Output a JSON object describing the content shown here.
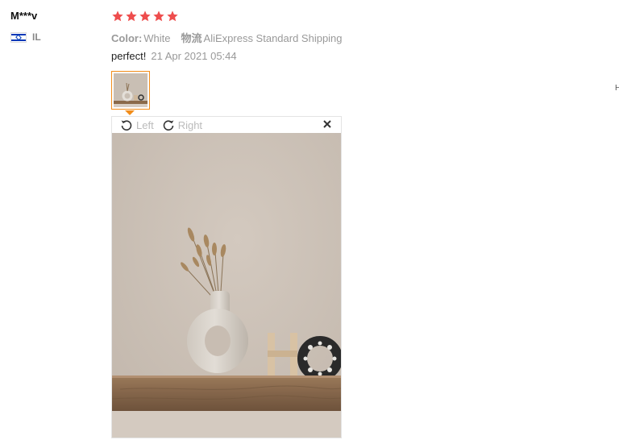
{
  "reviewer": {
    "name": "M***v",
    "country_code": "IL",
    "flag_icon": "israel-flag-icon"
  },
  "rating": {
    "stars": 5,
    "max": 5,
    "color": "#ee4d4d"
  },
  "meta": {
    "color_label": "Color:",
    "color_value": "White",
    "shipping_label": "物流",
    "shipping_value": "AliExpress Standard Shipping"
  },
  "review": {
    "text": "perfect!",
    "date": "21 Apr 2021 05:44"
  },
  "viewer": {
    "rotate_left_label": "Left",
    "rotate_right_label": "Right",
    "close_icon": "close-icon",
    "accent_color": "#f28d1a"
  },
  "side_text": "H"
}
